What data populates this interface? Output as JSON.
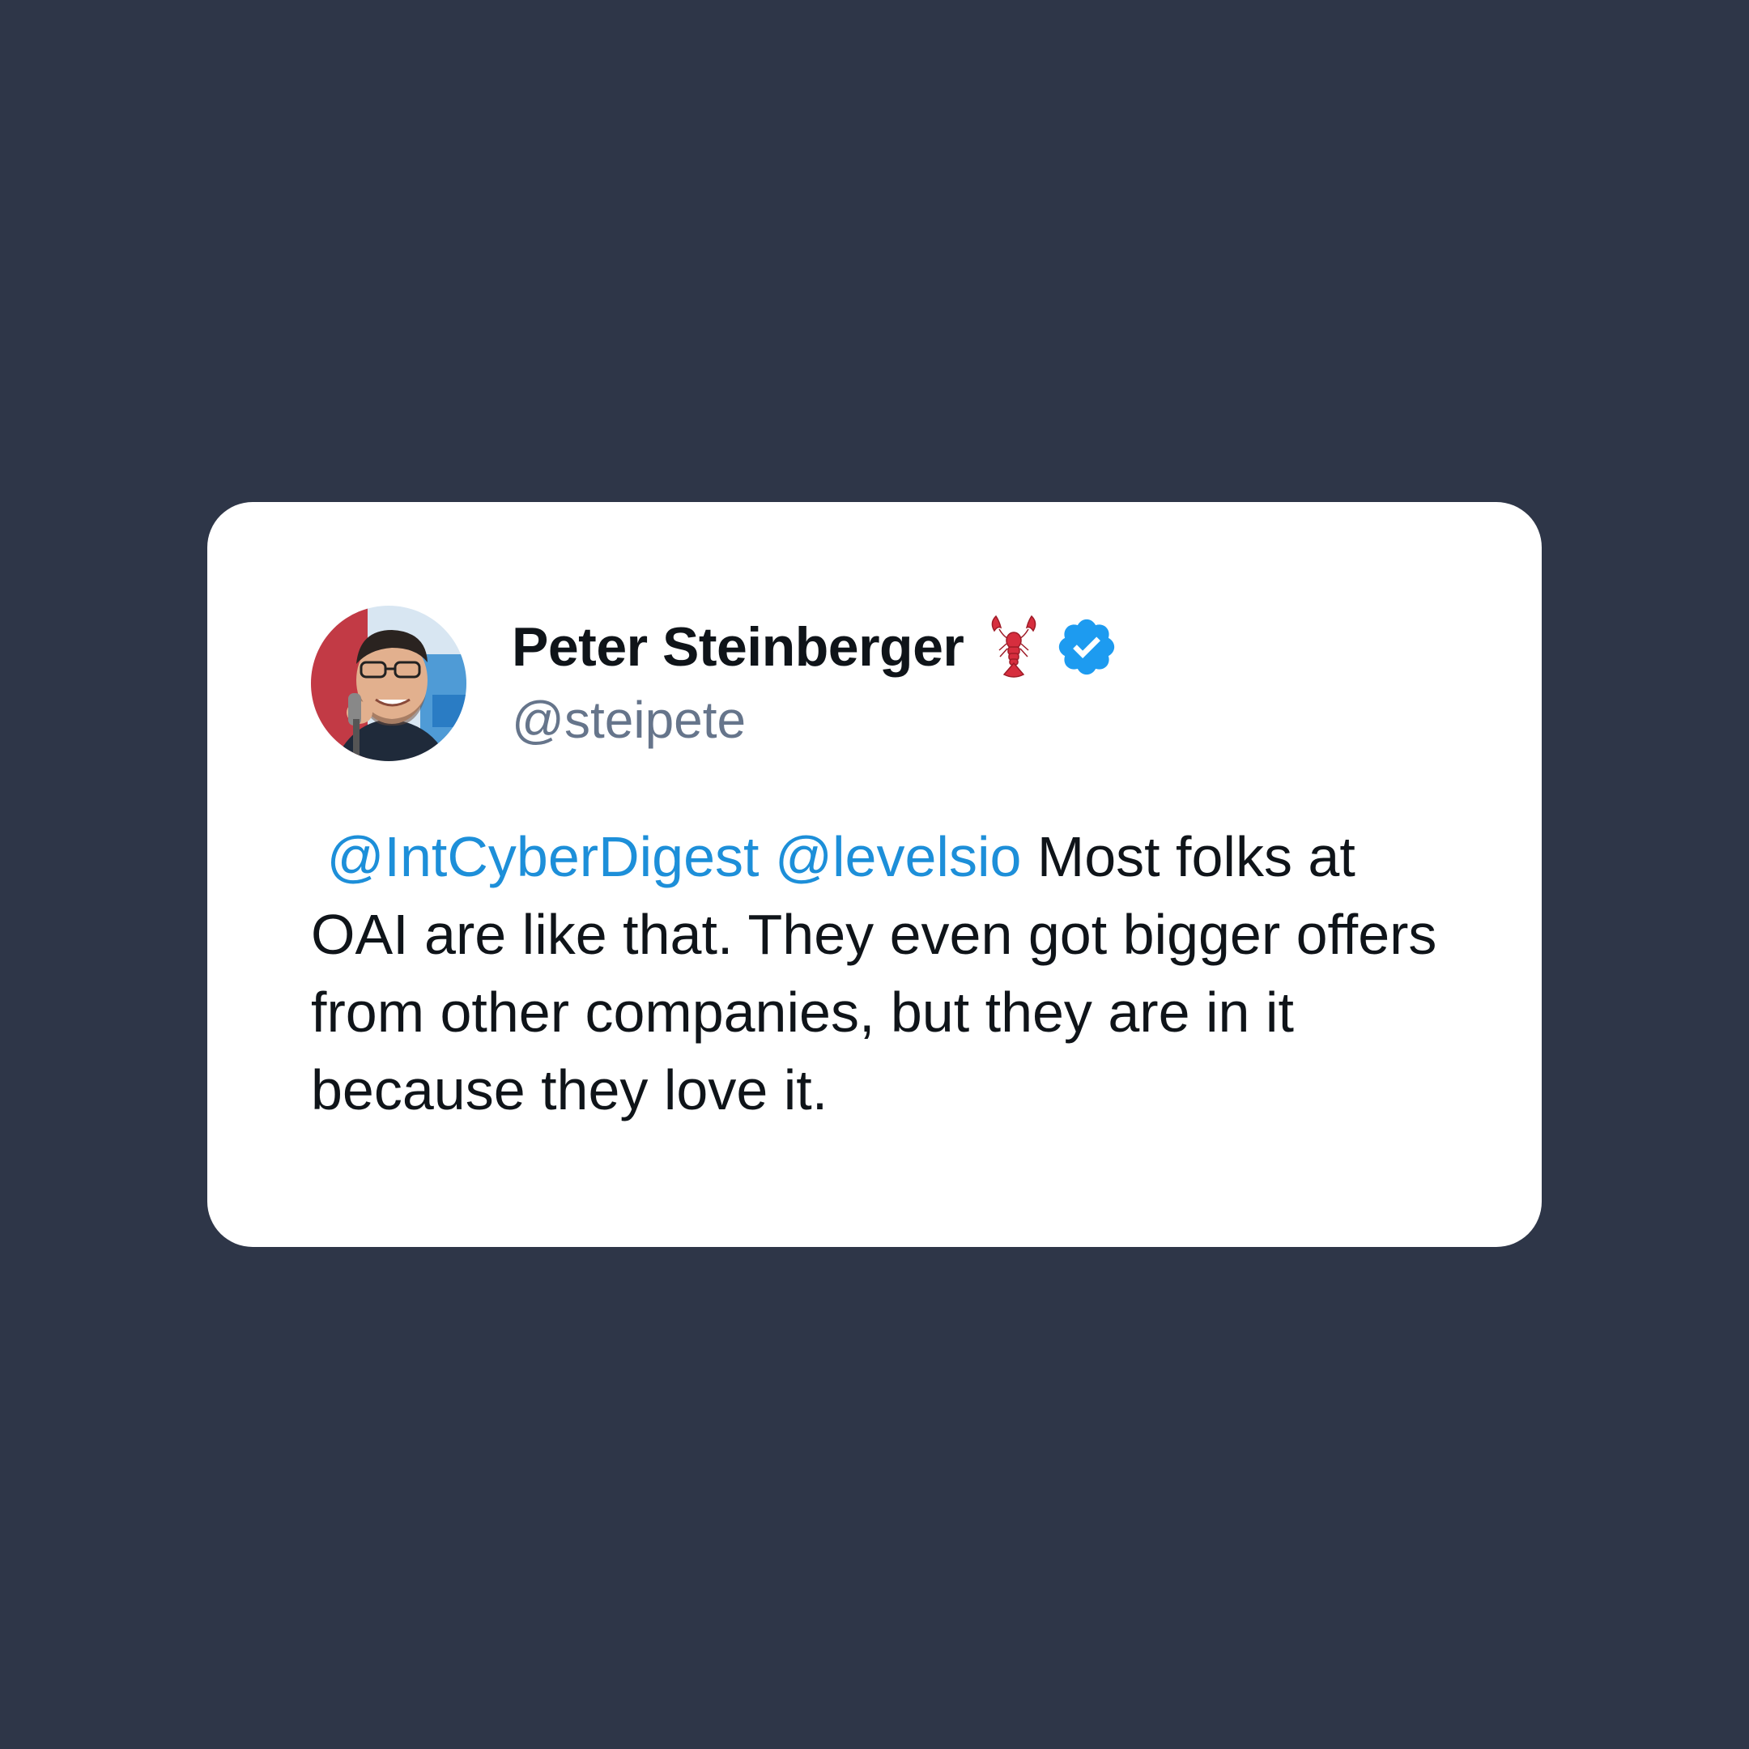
{
  "tweet": {
    "author": {
      "display_name": "Peter Steinberger",
      "handle": "@steipete",
      "emoji": "lobster-icon",
      "verified": true,
      "verified_icon": "verified-badge-icon",
      "avatar": "avatar-photo"
    },
    "mentions": [
      "@IntCyberDigest",
      "@levelsio"
    ],
    "body_text": "Most folks at OAI are like that. They even got bigger offers from other companies, but they are in it because they love it."
  },
  "colors": {
    "background": "#2e3648",
    "card": "#ffffff",
    "text": "#0f1419",
    "handle": "#66758b",
    "mention": "#1d8fd9",
    "verified": "#1d9bf0"
  }
}
